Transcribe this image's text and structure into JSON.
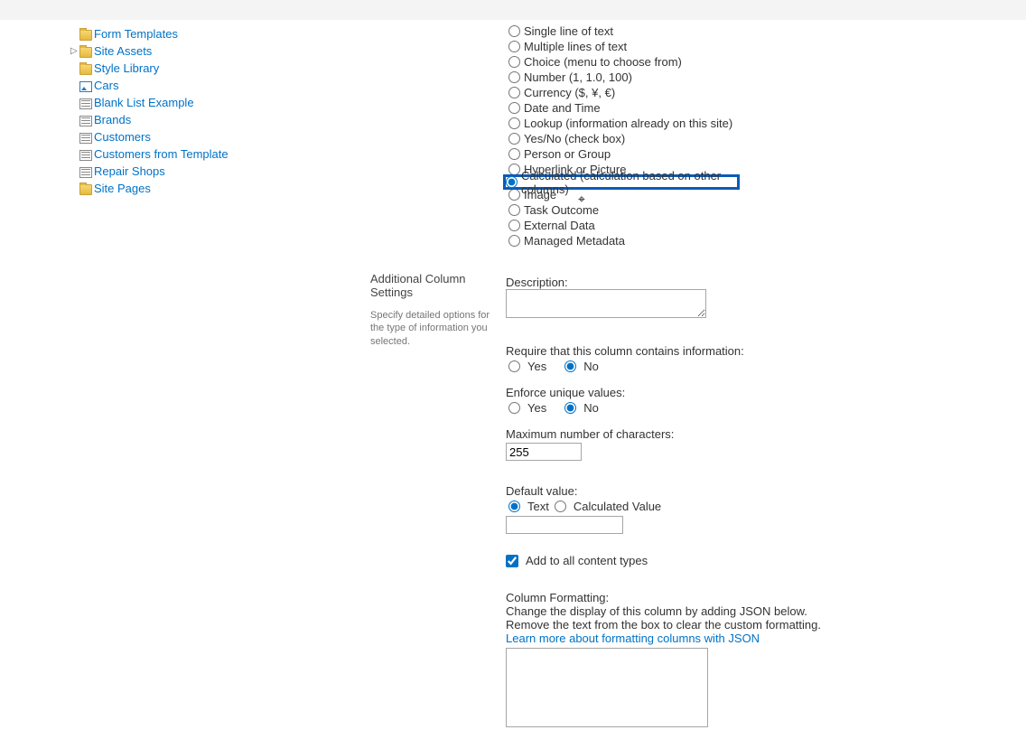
{
  "sidebar": {
    "items": [
      {
        "label": "Form Templates",
        "icon": "folder",
        "caret": ""
      },
      {
        "label": "Site Assets",
        "icon": "folder",
        "caret": "▷"
      },
      {
        "label": "Style Library",
        "icon": "folder",
        "caret": ""
      },
      {
        "label": "Cars",
        "icon": "pic",
        "caret": ""
      },
      {
        "label": "Blank List Example",
        "icon": "list",
        "caret": ""
      },
      {
        "label": "Brands",
        "icon": "list",
        "caret": ""
      },
      {
        "label": "Customers",
        "icon": "list",
        "caret": ""
      },
      {
        "label": "Customers from Template",
        "icon": "list",
        "caret": ""
      },
      {
        "label": "Repair Shops",
        "icon": "list",
        "caret": ""
      },
      {
        "label": "Site Pages",
        "icon": "folder",
        "caret": ""
      }
    ]
  },
  "column_types": {
    "options": [
      "Single line of text",
      "Multiple lines of text",
      "Choice (menu to choose from)",
      "Number (1, 1.0, 100)",
      "Currency ($, ¥, €)",
      "Date and Time",
      "Lookup (information already on this site)",
      "Yes/No (check box)",
      "Person or Group",
      "Hyperlink or Picture",
      "Calculated (calculation based on other columns)",
      "Image",
      "Task Outcome",
      "External Data",
      "Managed Metadata"
    ],
    "selected_index": 10
  },
  "sections": {
    "additional": {
      "title": "Additional Column Settings",
      "desc": "Specify detailed options for the type of information you selected."
    }
  },
  "fields": {
    "description_label": "Description:",
    "description_value": "",
    "require_label": "Require that this column contains information:",
    "require_yes": "Yes",
    "require_no": "No",
    "require_selected": "No",
    "unique_label": "Enforce unique values:",
    "unique_yes": "Yes",
    "unique_no": "No",
    "unique_selected": "No",
    "maxchars_label": "Maximum number of characters:",
    "maxchars_value": "255",
    "default_label": "Default value:",
    "default_text": "Text",
    "default_calc": "Calculated Value",
    "default_selected": "Text",
    "default_value": "",
    "add_ct_label": "Add to all content types",
    "add_ct_checked": true,
    "formatting_title": "Column Formatting:",
    "formatting_line1": "Change the display of this column by adding JSON below.",
    "formatting_line2": "Remove the text from the box to clear the custom formatting.",
    "formatting_link": "Learn more about formatting columns with JSON",
    "formatting_value": ""
  }
}
